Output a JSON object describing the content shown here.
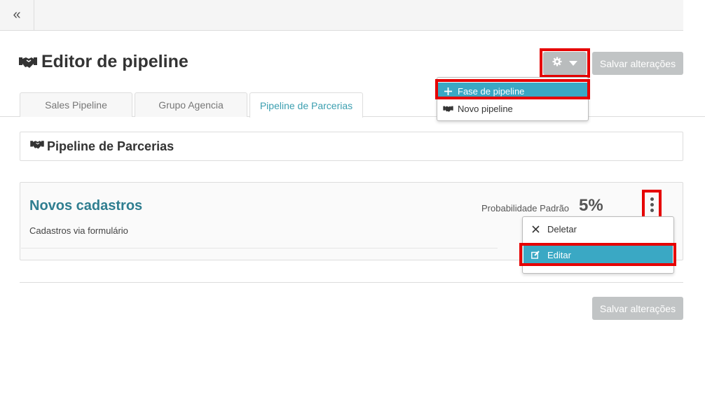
{
  "topbar": {
    "collapse_glyph": "«"
  },
  "page": {
    "title": "Editor de pipeline",
    "title_icon": "handshake-icon"
  },
  "toolbar": {
    "settings_icon": "gear-icon",
    "caret_icon": "caret-down-icon",
    "save_label": "Salvar alterações"
  },
  "tabs": [
    {
      "label": "Sales Pipeline",
      "active": false
    },
    {
      "label": "Grupo Agencia",
      "active": false
    },
    {
      "label": "Pipeline de Parcerias",
      "active": true
    }
  ],
  "settings_menu": {
    "items": [
      {
        "label": "Fase de pipeline",
        "icon": "plus-icon",
        "highlighted": true
      },
      {
        "label": "Novo pipeline",
        "icon": "handshake-icon",
        "highlighted": false
      }
    ]
  },
  "pipeline": {
    "name": "Pipeline de Parcerias"
  },
  "stage": {
    "name": "Novos cadastros",
    "description": "Cadastros via formulário",
    "probability_label": "Probabilidade Padrão",
    "probability_value": "5%"
  },
  "stage_menu": {
    "items": [
      {
        "label": "Deletar",
        "icon": "close-icon",
        "highlighted": false
      },
      {
        "label": "Editar",
        "icon": "edit-icon",
        "highlighted": true
      }
    ]
  },
  "footer": {
    "save_label": "Salvar alterações"
  },
  "colors": {
    "accent": "#3aa8c4",
    "stage_title": "#2f7e90",
    "highlight_box": "#e60000",
    "button_gray": "#c1c4c5"
  }
}
